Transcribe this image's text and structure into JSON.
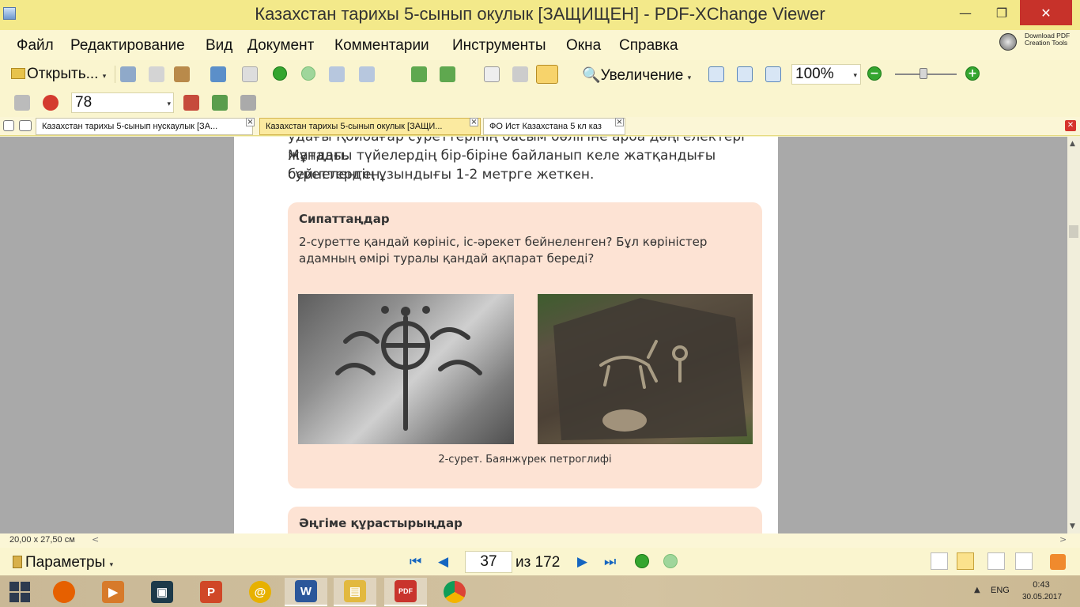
{
  "window": {
    "title": "Казахстан тарихы 5-сынып окулык [ЗАЩИЩЕН] - PDF-XChange Viewer",
    "min_glyph": "—",
    "max_glyph": "❐",
    "close_glyph": "✕"
  },
  "menu": {
    "items": [
      "Файл",
      "Редактирование",
      "Вид",
      "Документ",
      "Комментарии",
      "Инструменты",
      "Окна",
      "Справка"
    ],
    "download_pdf": "Download PDF Creation Tools"
  },
  "toolbar": {
    "open_label": "Открыть...",
    "zoom_tool_label": "Увеличение",
    "zoom_value": "100%",
    "zoom_out_glyph": "−",
    "zoom_in_glyph": "+",
    "value_field": "78",
    "caret": "▾"
  },
  "tabs": [
    {
      "label": "Казахстан тарихы 5-сынып нускаулык [ЗА..."
    },
    {
      "label": "Казахстан тарихы 5-сынып окулык [ЗАЩИ..."
    },
    {
      "label": "ФО Ист Казахстана 5 кл  каз"
    }
  ],
  "tab_close_glyph": "×",
  "document": {
    "text_top_partial": "удағы Қойбағар суреттерінің басым бөлігіне арба дөңгелектері жатады.",
    "paragraph_line1": "Мұндағы түйелердің бір-біріне байланып келе жатқандығы бейнеленген,",
    "paragraph_line2": "суреттердің ұзындығы 1-2 метрге жеткен.",
    "card1": {
      "title": "Сипаттаңдар",
      "question": "2-суретте қандай көрініс, іс-әрекет бейнеленген? Бұл көріністер адамның өмірі туралы қандай ақпарат береді?",
      "caption": "2-сурет. Баянжүрек петроглифі"
    },
    "card2": {
      "title": "Әңгіме құрастырыңдар"
    }
  },
  "status": {
    "page_size": "20,00 x 27,50 см",
    "scroll_left_glyph": "<",
    "scroll_right_glyph": ">",
    "scroll_up_glyph": "▲",
    "scroll_down_glyph": "▼"
  },
  "navigation": {
    "params_label": "Параметры",
    "current_page": "37",
    "page_of": "из 172",
    "first_glyph": "⏮",
    "prev_glyph": "◀",
    "next_glyph": "▶",
    "last_glyph": "⏭"
  },
  "taskbar": {
    "lang": "ENG",
    "time": "0:43",
    "date": "30.05.2017",
    "tray_caret": "▲",
    "apps": [
      {
        "name": "firefox",
        "glyph": "",
        "color": "#e66000"
      },
      {
        "name": "media",
        "glyph": "▶",
        "color": "#d77a2a"
      },
      {
        "name": "video-editor",
        "glyph": "▣",
        "color": "#1d3a4a"
      },
      {
        "name": "powerpoint",
        "glyph": "P",
        "color": "#d04727"
      },
      {
        "name": "mail",
        "glyph": "@",
        "color": "#e7b100"
      },
      {
        "name": "word",
        "glyph": "W",
        "color": "#2b579a"
      },
      {
        "name": "explorer",
        "glyph": "▤",
        "color": "#e2b940"
      },
      {
        "name": "pdf-viewer",
        "glyph": "PDF",
        "color": "#c9342d"
      },
      {
        "name": "chrome",
        "glyph": "",
        "color": "#db4437"
      }
    ]
  }
}
